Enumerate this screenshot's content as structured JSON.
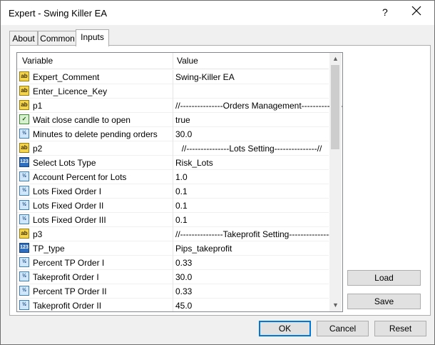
{
  "window": {
    "title": "Expert - Swing Killer EA",
    "help_glyph": "?",
    "close_icon": "close-icon"
  },
  "tabs": [
    {
      "label": "About",
      "active": false
    },
    {
      "label": "Common",
      "active": false
    },
    {
      "label": "Inputs",
      "active": true
    }
  ],
  "grid": {
    "header": {
      "variable": "Variable",
      "value": "Value"
    },
    "rows": [
      {
        "icon": "ab",
        "variable": "Expert_Comment",
        "value": "Swing-Killer EA"
      },
      {
        "icon": "ab",
        "variable": "Enter_Licence_Key",
        "value": ""
      },
      {
        "icon": "ab",
        "variable": "p1",
        "value": "//---------------Orders Management---------------//"
      },
      {
        "icon": "bool",
        "variable": "Wait close candle to open",
        "value": "true"
      },
      {
        "icon": "half",
        "variable": "Minutes to delete pending orders",
        "value": "30.0"
      },
      {
        "icon": "ab",
        "variable": "p2",
        "value": "//---------------Lots Setting---------------//"
      },
      {
        "icon": "num",
        "variable": "Select Lots Type",
        "value": "Risk_Lots"
      },
      {
        "icon": "half",
        "variable": "Account Percent for Lots",
        "value": "1.0"
      },
      {
        "icon": "half",
        "variable": "Lots Fixed Order I",
        "value": "0.1"
      },
      {
        "icon": "half",
        "variable": "Lots Fixed Order II",
        "value": "0.1"
      },
      {
        "icon": "half",
        "variable": "Lots Fixed Order III",
        "value": "0.1"
      },
      {
        "icon": "ab",
        "variable": "p3",
        "value": "//---------------Takeprofit Setting---------------//"
      },
      {
        "icon": "num",
        "variable": "TP_type",
        "value": "Pips_takeprofit"
      },
      {
        "icon": "half",
        "variable": "Percent TP Order I",
        "value": "0.33"
      },
      {
        "icon": "half",
        "variable": "Takeprofit Order I",
        "value": "30.0"
      },
      {
        "icon": "half",
        "variable": "Percent TP Order II",
        "value": "0.33"
      },
      {
        "icon": "half",
        "variable": "Takeprofit Order II",
        "value": "45.0"
      }
    ]
  },
  "icon_glyphs": {
    "ab": "ab",
    "half": "½",
    "num": "123",
    "bool": "✓"
  },
  "buttons": {
    "load": "Load",
    "save": "Save",
    "ok": "OK",
    "cancel": "Cancel",
    "reset": "Reset"
  }
}
